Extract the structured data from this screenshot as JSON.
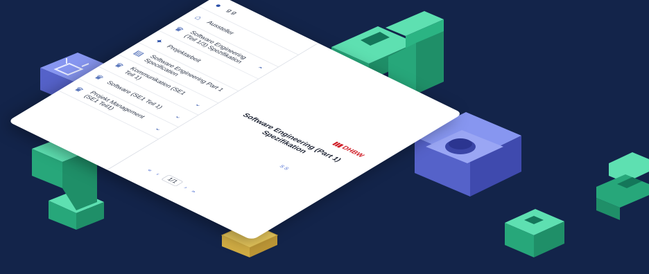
{
  "sidebar": {
    "items": [
      {
        "icon": "user-circle-icon",
        "label": "g g"
      },
      {
        "icon": "bank-icon",
        "label": "Aussteller"
      },
      {
        "icon": "trophy-icon",
        "label": "Software Engineering (Teil 1/3) Spezifikation",
        "chevron": "up"
      },
      {
        "icon": "walking-person-icon",
        "label": "Projektarbeit"
      },
      {
        "icon": "document-icon",
        "label": "Software Engineering Part 1 Specification"
      },
      {
        "icon": "trophy-icon",
        "label": "Kommunikation (SE1 Teil 1)",
        "chevron": "down"
      },
      {
        "icon": "trophy-icon",
        "label": "Software (SE1 Teil 1)",
        "chevron": "down"
      },
      {
        "icon": "trophy-icon",
        "label": "Projekt Management (SE1 Teil1)",
        "chevron": "down"
      }
    ]
  },
  "document": {
    "logo": "DHBW",
    "title": "Software Engineering (Part 1) Spezifikation",
    "link": "S S"
  },
  "pager": {
    "first": "«",
    "prev": "‹",
    "page": "1/1",
    "next": "›",
    "last": "»"
  },
  "colors": {
    "background": "#13244a",
    "green": "#3fcf9a",
    "blue": "#6f7fe0",
    "gold": "#f1dd7e",
    "accent": "#2a4fa8"
  }
}
